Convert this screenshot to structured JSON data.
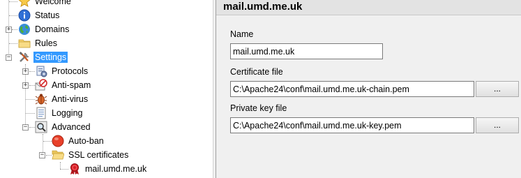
{
  "tree": {
    "items": [
      {
        "label": "Welcome",
        "icon": "star-icon"
      },
      {
        "label": "Status",
        "icon": "info-icon"
      },
      {
        "label": "Domains",
        "icon": "globe-icon"
      },
      {
        "label": "Rules",
        "icon": "folder-icon"
      },
      {
        "label": "Settings",
        "icon": "tools-icon",
        "selected": true
      },
      {
        "label": "Protocols",
        "icon": "protocols-icon"
      },
      {
        "label": "Anti-spam",
        "icon": "anti-spam-icon"
      },
      {
        "label": "Anti-virus",
        "icon": "anti-virus-icon"
      },
      {
        "label": "Logging",
        "icon": "log-icon"
      },
      {
        "label": "Advanced",
        "icon": "magnifier-icon"
      },
      {
        "label": "Auto-ban",
        "icon": "red-circle-icon"
      },
      {
        "label": "SSL certificates",
        "icon": "folder-open-icon"
      },
      {
        "label": "mail.umd.me.uk",
        "icon": "certificate-ribbon-icon"
      }
    ],
    "toggles": {
      "plus": "+",
      "minus": "−"
    }
  },
  "panel": {
    "title": "mail.umd.me.uk",
    "name_label": "Name",
    "name_value": "mail.umd.me.uk",
    "cert_label": "Certificate file",
    "cert_value": "C:\\Apache24\\conf\\mail.umd.me.uk-chain.pem",
    "key_label": "Private key file",
    "key_value": "C:\\Apache24\\conf\\mail.umd.me.uk-key.pem",
    "browse_label": "..."
  }
}
